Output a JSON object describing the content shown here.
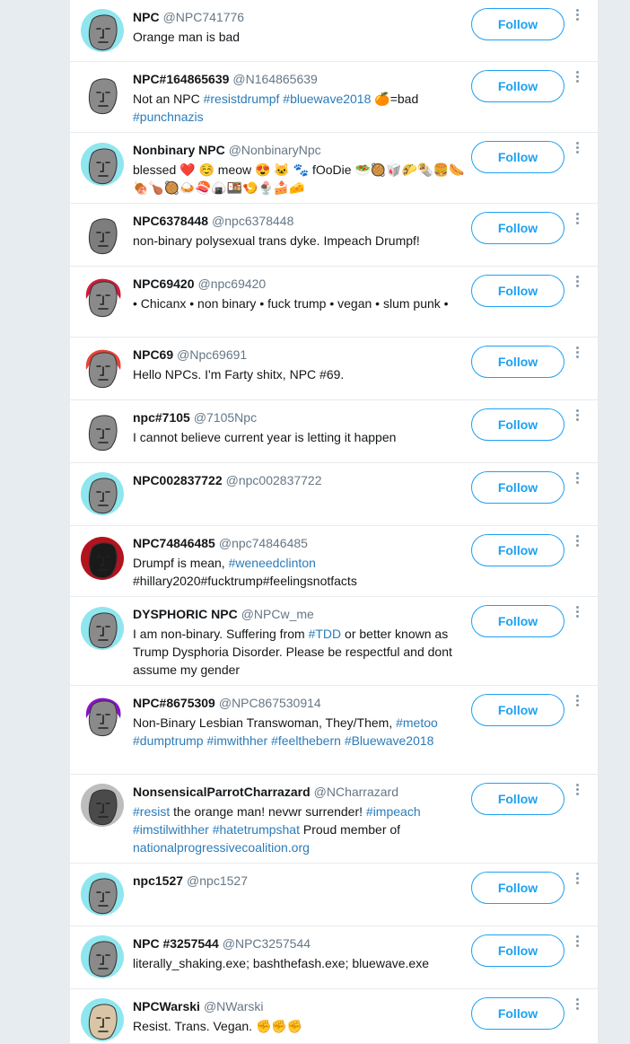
{
  "follow_label": "Follow",
  "users": [
    {
      "name": "NPC",
      "handle": "@NPC741776",
      "bio": [
        {
          "t": "Orange man is bad"
        }
      ],
      "avatar": {
        "bg": "#8fe6ee",
        "face": "#8a8a8a"
      }
    },
    {
      "name": "NPC#164865639",
      "handle": "@N164865639",
      "bio": [
        {
          "t": "Not an NPC "
        },
        {
          "t": "#resistdrumpf",
          "tag": true
        },
        {
          "t": " "
        },
        {
          "t": "#bluewave2018",
          "tag": true
        },
        {
          "t": " 🍊=bad "
        },
        {
          "t": "#punchnazis",
          "tag": true
        }
      ],
      "avatar": {
        "bg": "#ffffff",
        "face": "#8a8a8a"
      }
    },
    {
      "name": "Nonbinary NPC",
      "handle": "@NonbinaryNpc",
      "bio": [
        {
          "t": "blessed ❤️ ☺️ meow 😍 🐱 🐾 fOoDie 🥗🥘🥡🌮🌯🍔🌭🍖🍗🥘🍛🍣🍙🍱🍤🍨🍰🧀"
        }
      ],
      "avatar": {
        "bg": "#8fe6ee",
        "face": "#8a8a8a"
      }
    },
    {
      "name": "NPC6378448",
      "handle": "@npc6378448",
      "bio": [
        {
          "t": "non-binary polysexual trans dyke. Impeach Drumpf!"
        }
      ],
      "avatar": {
        "bg": "#ffffff",
        "face": "#7d7d7d"
      }
    },
    {
      "name": "NPC69420",
      "handle": "@npc69420",
      "bio": [
        {
          "t": "• Chicanx • non binary • fuck trump • vegan • slum punk •"
        }
      ],
      "avatar": {
        "bg": "#ffffff",
        "face": "#8a8a8a",
        "hair": "#d01b3a"
      }
    },
    {
      "name": "NPC69",
      "handle": "@Npc69691",
      "bio": [
        {
          "t": "Hello NPCs. I'm Farty shitx, NPC #69."
        }
      ],
      "avatar": {
        "bg": "#ffffff",
        "face": "#8a8a8a",
        "hair": "#e8433a"
      }
    },
    {
      "name": "npc#7105",
      "handle": "@7105Npc",
      "bio": [
        {
          "t": "I cannot believe current year is letting it happen"
        }
      ],
      "avatar": {
        "bg": "#ffffff",
        "face": "#8a8a8a"
      }
    },
    {
      "name": "NPC002837722",
      "handle": "@npc002837722",
      "bio": [],
      "avatar": {
        "bg": "#8fe6ee",
        "face": "#8a8a8a"
      }
    },
    {
      "name": "NPC74846485",
      "handle": "@npc74846485",
      "bio": [
        {
          "t": "Drumpf is mean, "
        },
        {
          "t": "#weneedclinton",
          "tag": true
        },
        {
          "t": " #hillary2020#fucktrump#feelingsnotfacts"
        }
      ],
      "avatar": {
        "bg": "#b3121f",
        "face": "#1a1a1a"
      }
    },
    {
      "name": "DYSPHORIC NPC",
      "handle": "@NPCw_me",
      "bio": [
        {
          "t": "I am non-binary. Suffering from "
        },
        {
          "t": "#TDD",
          "tag": true
        },
        {
          "t": " or better known as Trump Dysphoria Disorder. Please be respectful and dont assume my gender"
        }
      ],
      "avatar": {
        "bg": "#8fe6ee",
        "face": "#8a8a8a"
      }
    },
    {
      "name": "NPC#8675309",
      "handle": "@NPC867530914",
      "bio": [
        {
          "t": "Non-Binary Lesbian Transwoman, They/Them, "
        },
        {
          "t": "#metoo",
          "tag": true
        },
        {
          "t": " "
        },
        {
          "t": "#dumptrump",
          "tag": true
        },
        {
          "t": " "
        },
        {
          "t": "#imwithher",
          "tag": true
        },
        {
          "t": " "
        },
        {
          "t": "#feelthebern",
          "tag": true
        },
        {
          "t": " "
        },
        {
          "t": "#Bluewave2018",
          "tag": true
        }
      ],
      "avatar": {
        "bg": "#ffffff",
        "face": "#8a8a8a",
        "hair": "#8b12c9"
      }
    },
    {
      "name": "NonsensicalParrotCharrazard",
      "handle": "@NCharrazard",
      "bio": [
        {
          "t": "#resist",
          "tag": true
        },
        {
          "t": " the orange man! nevwr surrender! "
        },
        {
          "t": "#impeach",
          "tag": true
        },
        {
          "t": " "
        },
        {
          "t": "#imstilwithher",
          "tag": true
        },
        {
          "t": " "
        },
        {
          "t": "#hatetrumpshat",
          "tag": true
        },
        {
          "t": " Proud member of "
        },
        {
          "t": "nationalprogressivecoalition.org",
          "tag": true
        }
      ],
      "avatar": {
        "bg": "#bdbdbd",
        "face": "#4a4a4a"
      }
    },
    {
      "name": "npc1527",
      "handle": "@npc1527",
      "bio": [],
      "avatar": {
        "bg": "#8fe6ee",
        "face": "#8a8a8a"
      }
    },
    {
      "name": "NPC #3257544",
      "handle": "@NPC3257544",
      "bio": [
        {
          "t": "literally_shaking.exe; bashthefash.exe; bluewave.exe"
        }
      ],
      "avatar": {
        "bg": "#8fe6ee",
        "face": "#8a8a8a"
      }
    },
    {
      "name": "NPCWarski",
      "handle": "@NWarski",
      "bio": [
        {
          "t": "Resist. Trans. Vegan. ✊✊✊"
        }
      ],
      "avatar": {
        "bg": "#8fe6ee",
        "face": "#d9c5a5"
      }
    }
  ]
}
